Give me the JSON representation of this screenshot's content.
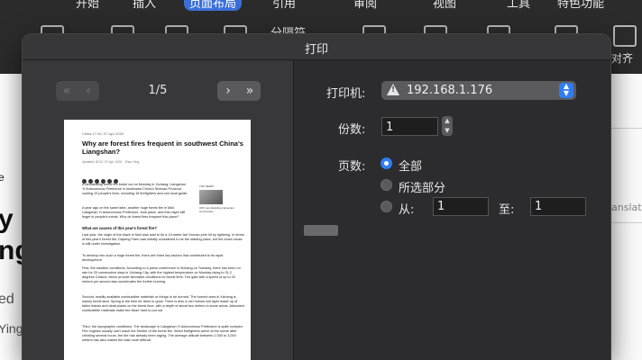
{
  "background_app": {
    "ribbon_tabs": [
      {
        "label": "开始",
        "active": false
      },
      {
        "label": "插入",
        "active": false
      },
      {
        "label": "页面布局",
        "active": true
      },
      {
        "label": "引用",
        "active": false
      },
      {
        "label": "审阅",
        "active": false
      },
      {
        "label": "视图",
        "active": false
      },
      {
        "label": "工具",
        "active": false
      },
      {
        "label": "特色功能",
        "active": false
      }
    ],
    "toolbar_item": "分隔符",
    "side_label": "对齐",
    "doc_fragments": {
      "left": [
        "e",
        "y",
        "ng",
        "ed",
        "Ying"
      ],
      "right": "anslat"
    },
    "accent_color": "#3b6fd8"
  },
  "dialog": {
    "title": "打印",
    "preview": {
      "page_indicator": "1/5",
      "prev_buttons": [
        "«",
        "‹"
      ],
      "next_buttons": [
        "›",
        "»"
      ],
      "article": {
        "meta": "China    17:44, 07-Apr-2020",
        "headline": "Why are forest fires frequent in southwest China's Liangshan?",
        "sub": "Updated 18:02, 07-Apr-2020  ·  Zhao Ying",
        "paragraphs": [
          "A devastating forest fire broke out on Monday in Xichang, Liangshan Yi Autonomous Prefecture in southwest China's Sichuan Province, costing 19 people's lives, including 18 firefighters and one local guide.",
          "A year ago on the same date, another huge forest fire in Muli, Liangshan Yi Autonomous Prefecture, took place, and this might still linger in people's minds. Why do forest fires frequent this place?"
        ],
        "section_title": "What are causes of this year's forest fire?",
        "section_paragraphs": [
          "Last year, the origin of the blaze in Muli was said to be a 19-meter-tall Yunnan pine hit by lightning. In terms of this year's forest fire, Dapeng Farm was initially considered to be the starting place, but the exact cause is still under investigation.",
          "To develop into such a huge forest fire, there are three key factors that contributed to its rapid development.",
          "First, the weather conditions. According to a press conference in Xichang on Tuesday, there has been no rain for 20 consecutive days in Xichang City, with the highest temperature on Monday rising to 31.2 degrees Celsius, which provide favorable conditions for forest fires. The gale with a speed of up to 20 meters per second also accelerates the further burning.",
          "Second, readily available combustible materials or things to be burned. The burned area in Xichang is mainly forest land. Spring is the time for trees to grow. There is also a rich humus soil layer made up of fallen leaves and dead plants on the forest floor, with a depth of about two meters in some areas. Abundant combustible materials make the blaze hard to put out.",
          "Third, the topographic conditions. The landscape in Liangshan Yi Autonomous Prefecture is quite complex. Fire engines usually can't reach the frontier of the forest fire. When firefighters arrive at the scene after climbing several hours, the fire has already been raging. The average altitude between 2,000 to 3,000 meters has also makes the task more difficult."
        ],
        "sidebar": {
          "label": "TOP NEWS",
          "caption": "CPC top discipline inspection commission"
        }
      }
    },
    "settings": {
      "printer_label": "打印机:",
      "printer_value": "192.168.1.176",
      "copies_label": "份数:",
      "copies_value": "1",
      "pages_label": "页数:",
      "option_all": "全部",
      "option_selection": "所选部分",
      "option_from": "从:",
      "from_value": "1",
      "to_label": "至:",
      "to_value": "1",
      "selected_option": "全部"
    },
    "colors": {
      "accent": "#2f7df6",
      "panel": "#2c2c2e"
    }
  }
}
